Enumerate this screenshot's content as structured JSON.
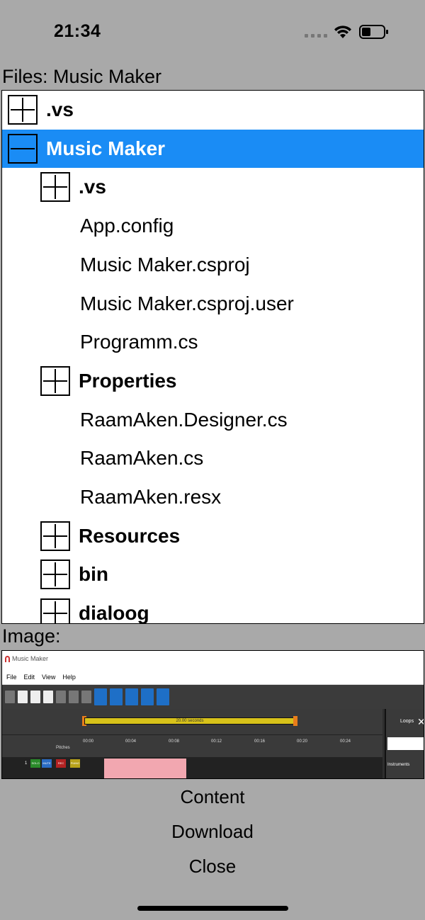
{
  "status_bar": {
    "time": "21:34"
  },
  "files": {
    "label": "Files: Music Maker",
    "items": [
      {
        "label": ".vs",
        "type": "folder",
        "expanded": false,
        "level": 0
      },
      {
        "label": "Music Maker",
        "type": "folder",
        "expanded": true,
        "level": 0,
        "selected": true
      },
      {
        "label": ".vs",
        "type": "folder",
        "expanded": false,
        "level": 1
      },
      {
        "label": "App.config",
        "type": "file",
        "level": 1
      },
      {
        "label": "Music Maker.csproj",
        "type": "file",
        "level": 1
      },
      {
        "label": "Music Maker.csproj.user",
        "type": "file",
        "level": 1
      },
      {
        "label": "Programm.cs",
        "type": "file",
        "level": 1
      },
      {
        "label": "Properties",
        "type": "folder",
        "expanded": false,
        "level": 1
      },
      {
        "label": "RaamAken.Designer.cs",
        "type": "file",
        "level": 1
      },
      {
        "label": "RaamAken.cs",
        "type": "file",
        "level": 1
      },
      {
        "label": "RaamAken.resx",
        "type": "file",
        "level": 1
      },
      {
        "label": "Resources",
        "type": "folder",
        "expanded": false,
        "level": 1
      },
      {
        "label": "bin",
        "type": "folder",
        "expanded": false,
        "level": 1
      },
      {
        "label": "dialoog",
        "type": "folder",
        "expanded": false,
        "level": 1
      }
    ]
  },
  "image": {
    "label": "Image:",
    "preview": {
      "app_title": "Music Maker",
      "menu": [
        "File",
        "Edit",
        "View",
        "Help"
      ],
      "timebar_text": "20.00 seconds",
      "ruler": [
        "00:00",
        "00:04",
        "00:08",
        "00:12",
        "00:16",
        "00:20",
        "00:24"
      ],
      "pitches_label": "Pitches",
      "track_number": "1",
      "track_buttons": [
        "SOLO",
        "MUTE",
        "REC",
        "PIANO"
      ],
      "loops_label": "Loops",
      "instruments_label": "Instruments"
    }
  },
  "actions": {
    "content": "Content",
    "download": "Download",
    "close": "Close"
  },
  "colors": {
    "background": "#a9a9a9",
    "selection": "#1a8cf5"
  }
}
